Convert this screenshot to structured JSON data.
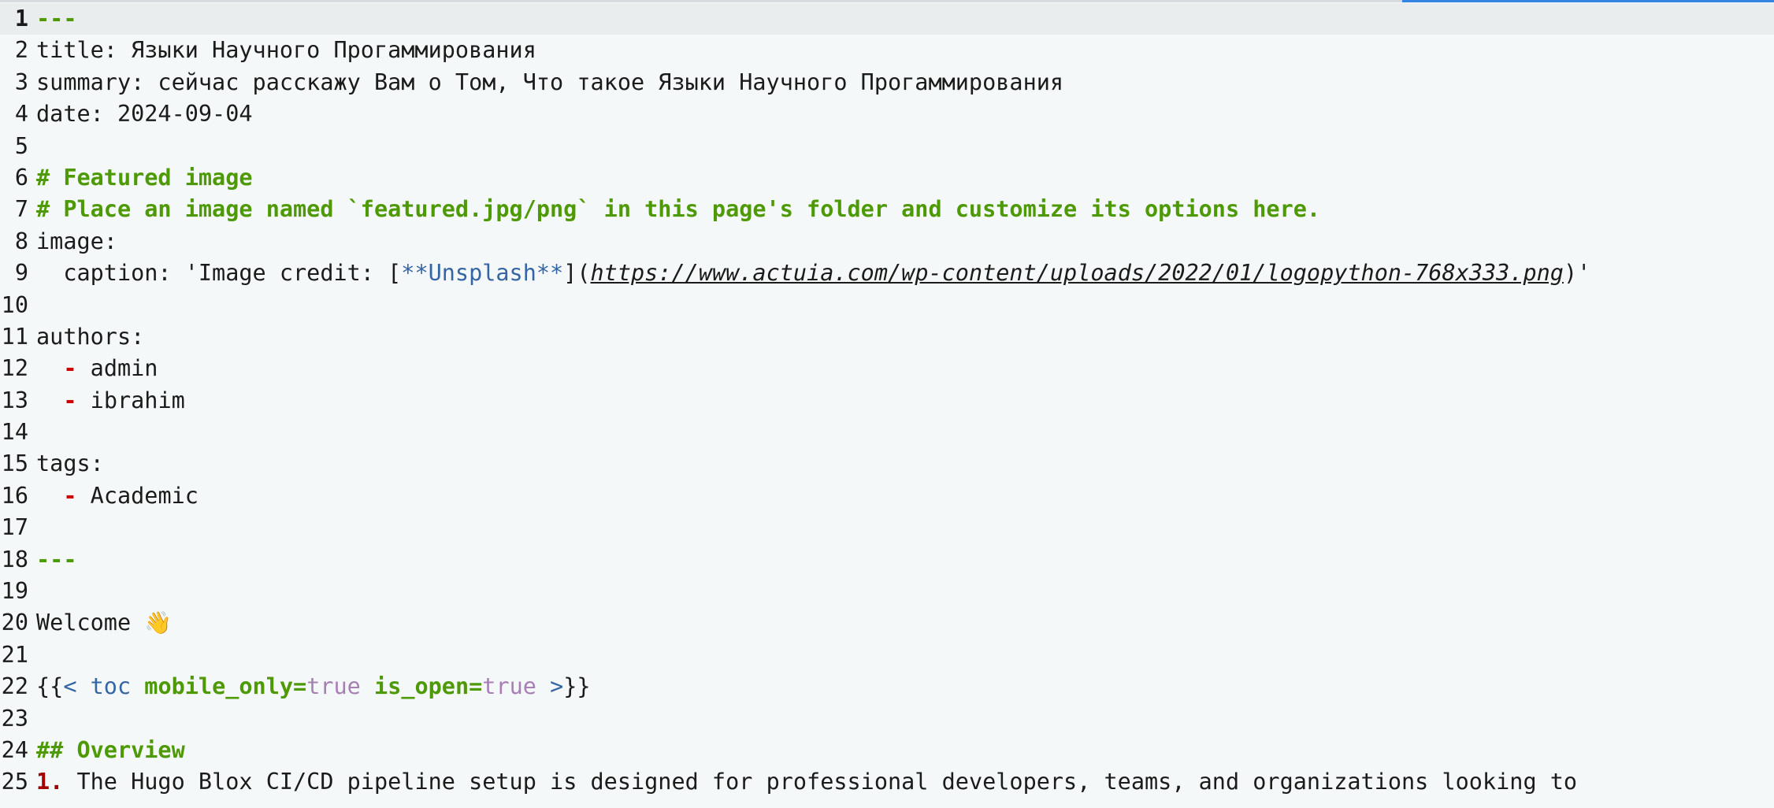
{
  "editor": {
    "lines": [
      {
        "num": "1",
        "segments": [
          {
            "t": "---",
            "c": "green"
          }
        ]
      },
      {
        "num": "2",
        "segments": [
          {
            "t": "title: Языки Научного Прогаммирования"
          }
        ]
      },
      {
        "num": "3",
        "segments": [
          {
            "t": "summary: сейчас расскажу Вам о Том, Что такое Языки Научного Прогаммирования"
          }
        ]
      },
      {
        "num": "4",
        "segments": [
          {
            "t": "date: 2024-09-04"
          }
        ]
      },
      {
        "num": "5",
        "segments": []
      },
      {
        "num": "6",
        "segments": [
          {
            "t": "# Featured image",
            "c": "heading"
          }
        ]
      },
      {
        "num": "7",
        "segments": [
          {
            "t": "# Place an image named `featured.jpg/png` in this page's folder and customize its options here.",
            "c": "heading"
          }
        ]
      },
      {
        "num": "8",
        "segments": [
          {
            "t": "image:"
          }
        ]
      },
      {
        "num": "9",
        "segments": [
          {
            "t": "  caption: 'Image credit: ["
          },
          {
            "t": "**Unsplash**",
            "c": "blue"
          },
          {
            "t": "]("
          },
          {
            "t": "https://www.actuia.com/wp-content/uploads/2022/01/logopython-768x333.png",
            "c": "link"
          },
          {
            "t": ")'"
          }
        ]
      },
      {
        "num": "10",
        "segments": []
      },
      {
        "num": "11",
        "segments": [
          {
            "t": "authors:"
          }
        ]
      },
      {
        "num": "12",
        "segments": [
          {
            "t": "  "
          },
          {
            "t": "-",
            "c": "red"
          },
          {
            "t": " admin"
          }
        ]
      },
      {
        "num": "13",
        "segments": [
          {
            "t": "  "
          },
          {
            "t": "-",
            "c": "red"
          },
          {
            "t": " ibrahim"
          }
        ]
      },
      {
        "num": "14",
        "segments": []
      },
      {
        "num": "15",
        "segments": [
          {
            "t": "tags:"
          }
        ]
      },
      {
        "num": "16",
        "segments": [
          {
            "t": "  "
          },
          {
            "t": "-",
            "c": "red"
          },
          {
            "t": " Academic"
          }
        ]
      },
      {
        "num": "17",
        "segments": []
      },
      {
        "num": "18",
        "segments": [
          {
            "t": "---",
            "c": "green"
          }
        ]
      },
      {
        "num": "19",
        "segments": []
      },
      {
        "num": "20",
        "segments": [
          {
            "t": "Welcome "
          },
          {
            "t": "👋",
            "c": "emoji"
          }
        ]
      },
      {
        "num": "21",
        "segments": []
      },
      {
        "num": "22",
        "segments": [
          {
            "t": "{{"
          },
          {
            "t": "< toc ",
            "c": "blue"
          },
          {
            "t": "mobile_only=",
            "c": "green"
          },
          {
            "t": "true",
            "c": "purple"
          },
          {
            "t": " "
          },
          {
            "t": "is_open=",
            "c": "green"
          },
          {
            "t": "true",
            "c": "purple"
          },
          {
            "t": " >",
            "c": "blue"
          },
          {
            "t": "}}"
          }
        ]
      },
      {
        "num": "23",
        "segments": []
      },
      {
        "num": "24",
        "segments": [
          {
            "t": "## Overview",
            "c": "heading"
          }
        ]
      },
      {
        "num": "25",
        "segments": [
          {
            "t": "1.",
            "c": "darkred"
          },
          {
            "t": " The Hugo Blox CI/CD pipeline setup is designed for professional developers, teams, and organizations looking to"
          }
        ]
      }
    ]
  }
}
